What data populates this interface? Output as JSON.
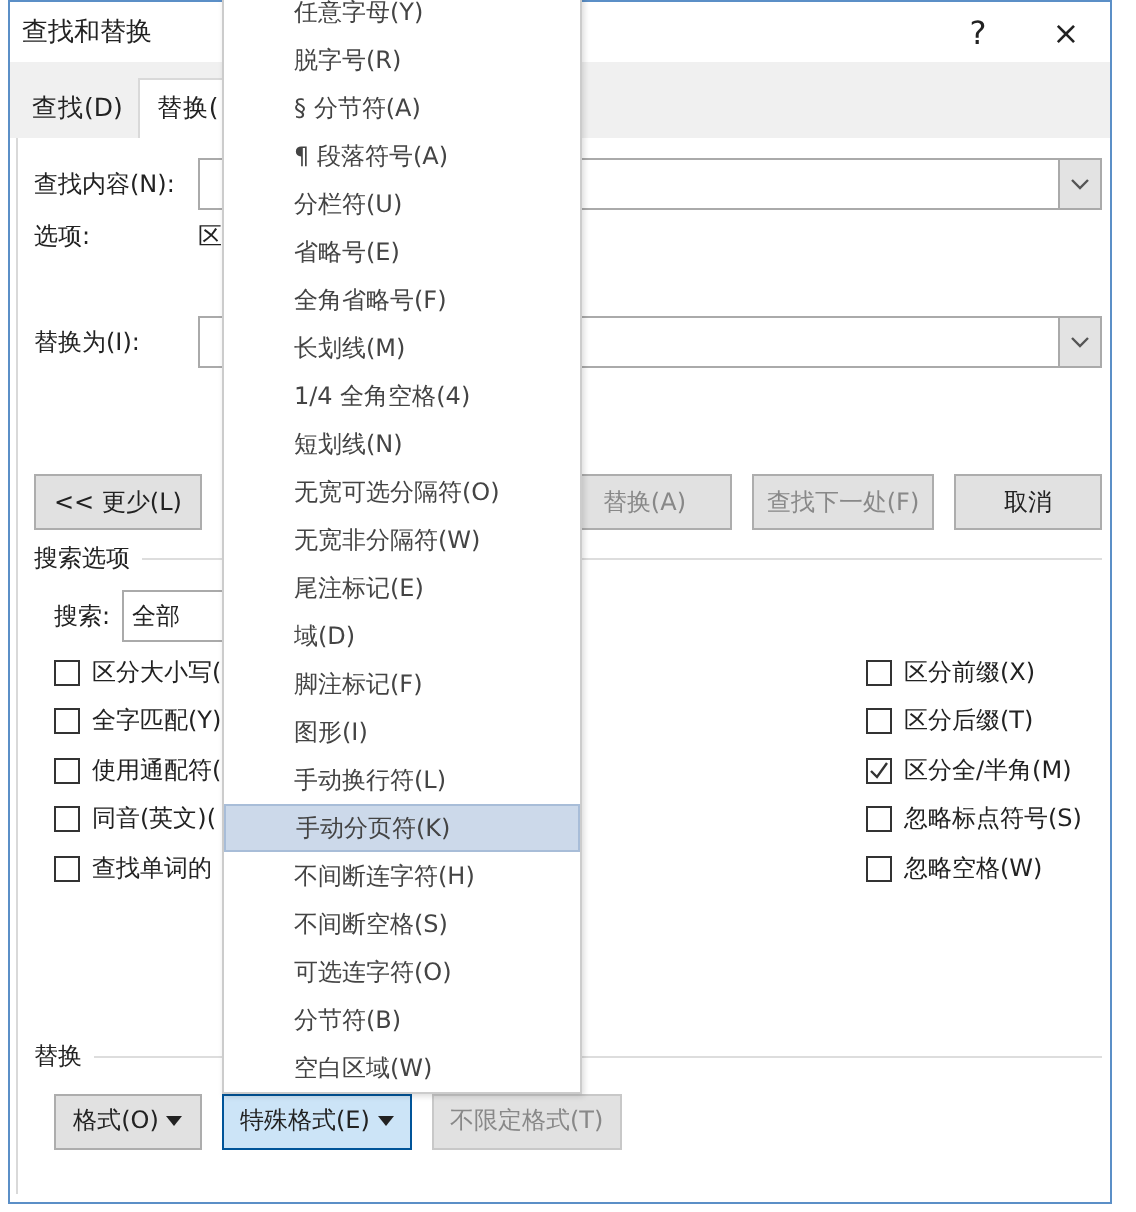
{
  "window": {
    "title": "查找和替换",
    "help_button": "?",
    "close_button": "×"
  },
  "tabs": [
    {
      "label": "查找(D)",
      "selected": false
    },
    {
      "label": "替换(",
      "selected": true
    }
  ],
  "find": {
    "label": "查找内容(N):",
    "options_label": "选项:",
    "options_value": "区"
  },
  "replace": {
    "label": "替换为(I):"
  },
  "buttons": [
    {
      "label": "<< 更少(L)",
      "disabled": false
    },
    {
      "label": "替换(A)",
      "disabled": true
    },
    {
      "label": "查找下一处(F)",
      "disabled": true
    },
    {
      "label": "取消",
      "disabled": false
    }
  ],
  "search_options": {
    "title": "搜索选项",
    "search_label": "搜索:",
    "search_value": "全部",
    "left_checkboxes": [
      {
        "label": "区分大小写(",
        "checked": false
      },
      {
        "label": "全字匹配(Y)",
        "checked": false
      },
      {
        "label": "使用通配符(",
        "checked": false
      },
      {
        "label": "同音(英文)(",
        "checked": false
      },
      {
        "label": "查找单词的",
        "checked": false
      }
    ],
    "right_checkboxes": [
      {
        "label": "区分前缀(X)",
        "checked": false
      },
      {
        "label": "区分后缀(T)",
        "checked": false
      },
      {
        "label": "区分全/半角(M)",
        "checked": true
      },
      {
        "label": "忽略标点符号(S)",
        "checked": false
      },
      {
        "label": "忽略空格(W)",
        "checked": false
      }
    ]
  },
  "replace_section": {
    "title": "替换",
    "buttons": [
      {
        "label": "格式(O)",
        "caret": true,
        "pressed": false,
        "disabled": false
      },
      {
        "label": "特殊格式(E)",
        "caret": true,
        "pressed": true,
        "disabled": false
      },
      {
        "label": "不限定格式(T)",
        "caret": false,
        "pressed": false,
        "disabled": true
      }
    ]
  },
  "menu": {
    "items": [
      {
        "label": "任意字母(Y)",
        "selected": false
      },
      {
        "label": "脱字号(R)",
        "selected": false
      },
      {
        "label": "§ 分节符(A)",
        "selected": false
      },
      {
        "label": "¶ 段落符号(A)",
        "selected": false
      },
      {
        "label": "分栏符(U)",
        "selected": false
      },
      {
        "label": "省略号(E)",
        "selected": false
      },
      {
        "label": "全角省略号(F)",
        "selected": false
      },
      {
        "label": "长划线(M)",
        "selected": false
      },
      {
        "label": "1/4 全角空格(4)",
        "selected": false
      },
      {
        "label": "短划线(N)",
        "selected": false
      },
      {
        "label": "无宽可选分隔符(O)",
        "selected": false
      },
      {
        "label": "无宽非分隔符(W)",
        "selected": false
      },
      {
        "label": "尾注标记(E)",
        "selected": false
      },
      {
        "label": "域(D)",
        "selected": false
      },
      {
        "label": "脚注标记(F)",
        "selected": false
      },
      {
        "label": "图形(I)",
        "selected": false
      },
      {
        "label": "手动换行符(L)",
        "selected": false
      },
      {
        "label": "手动分页符(K)",
        "selected": true
      },
      {
        "label": "不间断连字符(H)",
        "selected": false
      },
      {
        "label": "不间断空格(S)",
        "selected": false
      },
      {
        "label": "可选连字符(O)",
        "selected": false
      },
      {
        "label": "分节符(B)",
        "selected": false
      },
      {
        "label": "空白区域(W)",
        "selected": false
      }
    ]
  }
}
